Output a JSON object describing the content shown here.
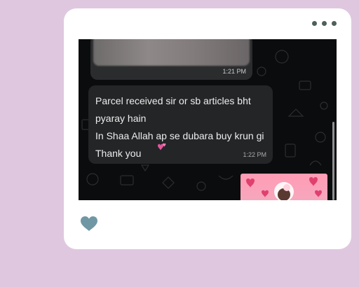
{
  "post_menu": {
    "icon": "more-horizontal-icon"
  },
  "chat": {
    "media_message": {
      "time": "1:21 PM"
    },
    "text_message": {
      "lines": [
        "Parcel received sir or sb articles bht",
        "pyaray hain",
        "In Shaa Allah ap se dubara buy krun gi",
        "Thank you"
      ],
      "emoji": "two-hearts-emoji",
      "time": "1:22 PM"
    }
  },
  "actions": {
    "like_icon": "heart-icon",
    "like_color": "#6f98a4"
  },
  "colors": {
    "background": "#dfc8df",
    "card": "#ffffff",
    "chat_background": "#0b0c0d",
    "bubble": "#232526"
  }
}
